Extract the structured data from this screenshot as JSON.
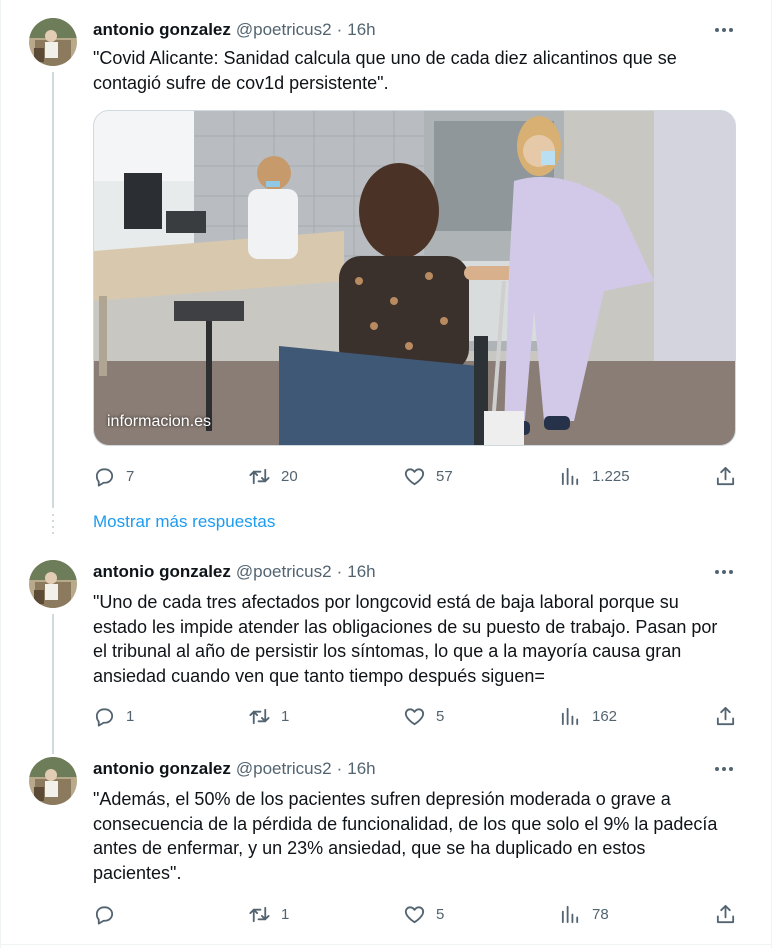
{
  "tweets": [
    {
      "author": "antonio gonzalez",
      "handle": "@poetricus2",
      "separator": "·",
      "time": "16h",
      "text": "\"Covid Alicante: Sanidad calcula que uno de cada diez alicantinos que se contagió sufre de cov1d persistente\".",
      "media": {
        "source_label": "informacion.es"
      },
      "replies": "7",
      "retweets": "20",
      "likes": "57",
      "views": "1.225"
    },
    {
      "author": "antonio gonzalez",
      "handle": "@poetricus2",
      "separator": "·",
      "time": "16h",
      "text": "\"Uno de cada tres afectados por longcovid está de baja laboral porque su estado les impide atender las obligaciones de su puesto de trabajo. Pasan por el tribunal al año de persistir los síntomas, lo que a la mayoría causa gran ansiedad cuando ven que tanto tiempo después siguen=",
      "replies": "1",
      "retweets": "1",
      "likes": "5",
      "views": "162"
    },
    {
      "author": "antonio gonzalez",
      "handle": "@poetricus2",
      "separator": "·",
      "time": "16h",
      "text": "\"Además, el 50% de los pacientes sufren depresión moderada o grave a consecuencia de la pérdida de funcionalidad, de los que solo el 9% la padecía antes de enfermar, y un 23% ansiedad, que se ha duplicado en estos pacientes\".",
      "replies": "",
      "retweets": "1",
      "likes": "5",
      "views": "78"
    }
  ],
  "show_more_replies": "Mostrar más respuestas",
  "colors": {
    "link": "#1d9bf0",
    "muted": "#536471",
    "text": "#0f1419",
    "border": "#cfd9de"
  },
  "icons": [
    "more-icon",
    "reply-icon",
    "retweet-icon",
    "like-icon",
    "views-icon",
    "share-icon"
  ]
}
